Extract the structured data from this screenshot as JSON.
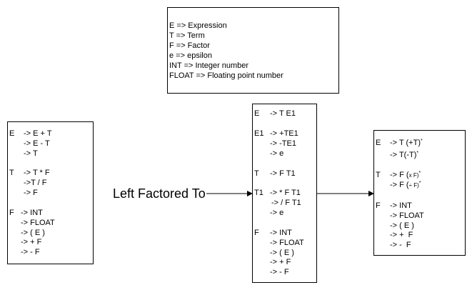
{
  "legend": [
    "E => Expression",
    "T => Term",
    "F => Factor",
    "e => epsilon",
    "INT => Integer number",
    "FLOAT => Floating point number"
  ],
  "left_grammar": {
    "E": [
      "-> E + T",
      "-> E - T",
      "-> T"
    ],
    "T": [
      "-> T * F",
      "->T / F",
      "-> F"
    ],
    "F": [
      "-> INT",
      "-> FLOAT",
      "-> ( E )",
      "-> + F",
      "-> - F"
    ]
  },
  "middle_grammar": {
    "E": [
      "-> T E1"
    ],
    "E1": [
      "-> +TE1",
      "-> -TE1",
      "-> e"
    ],
    "T": [
      "-> F T1"
    ],
    "T1": [
      "-> * F T1",
      "-> / F T1",
      "-> e"
    ],
    "F": [
      "-> INT",
      "-> FLOAT",
      "-> ( E )",
      "-> + F",
      "-> - F"
    ]
  },
  "right_grammar": {
    "E": [
      "-> T (+T)",
      "-> T(-T)"
    ],
    "T": [
      "-> F (",
      "-> F ("
    ],
    "T_inner": [
      "x F)",
      "÷ F)"
    ],
    "star": "*",
    "F": [
      "-> INT",
      "-> FLOAT",
      "-> ( E )",
      "-> +  F",
      "-> -  F"
    ]
  },
  "edge_label": "Left Factored To"
}
